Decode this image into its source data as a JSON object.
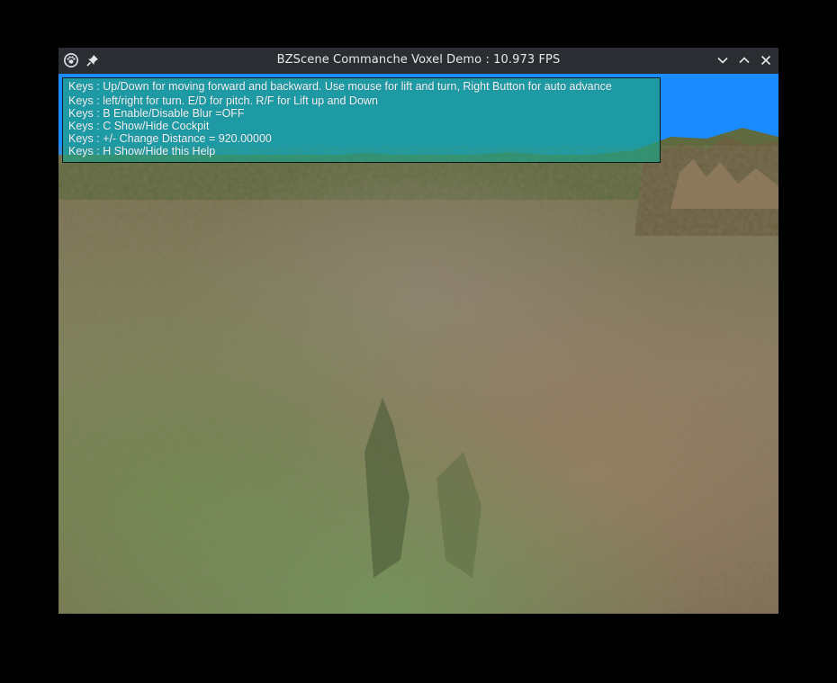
{
  "window": {
    "title": "BZScene Commanche Voxel Demo : 10.973 FPS"
  },
  "titlebar_icons": {
    "app": "app-icon",
    "pin": "pin-icon",
    "minimize": "chevron-down-icon",
    "maximize": "chevron-up-icon",
    "close": "close-icon"
  },
  "help": {
    "lines": [
      "Keys : Up/Down for moving forward and backward. Use mouse for lift and turn, Right Button for auto advance",
      "Keys : left/right for turn. E/D for pitch. R/F for Lift up and Down",
      "Keys : B Enable/Disable Blur =OFF",
      "Keys : C Show/Hide Cockpit",
      "Keys : +/- Change Distance = 920.00000",
      "Keys : H Show/Hide this Help"
    ]
  },
  "colors": {
    "sky": "#1a8cff",
    "help_panel": "#20a082",
    "titlebar": "#2a2e32"
  }
}
